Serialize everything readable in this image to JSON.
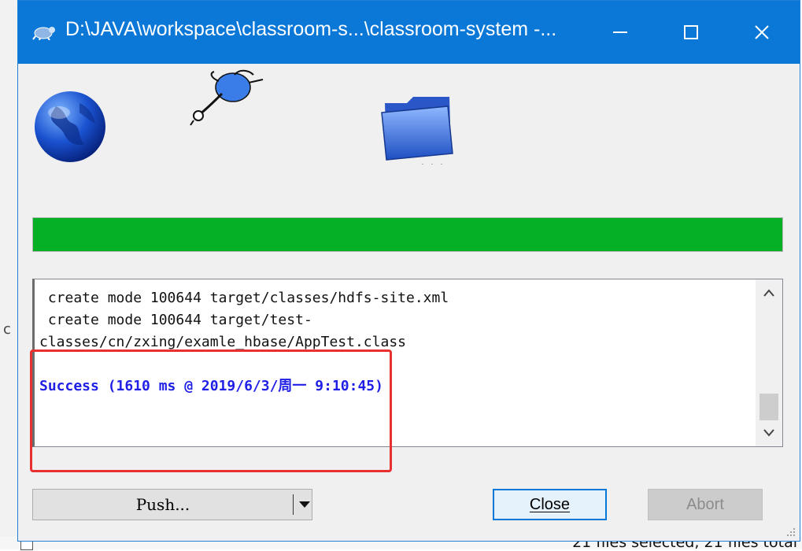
{
  "window": {
    "title": "D:\\JAVA\\workspace\\classroom-s...\\classroom-system -...",
    "minimize_label": "—",
    "maximize_label": "☐",
    "close_label": "✕"
  },
  "icons": {
    "app": "tortoise-git-icon",
    "globe": "globe-icon",
    "transfer": "jumping-figure-icon",
    "folder": "folder-icon"
  },
  "progress": {
    "value_percent": 100,
    "color": "#06b025"
  },
  "log": {
    "lines": [
      " create mode 100644 target/classes/hdfs-site.xml",
      " create mode 100644 target/test-",
      "classes/cn/zxing/examle_hbase/AppTest.class",
      "",
      "Success (1610 ms @ 2019/6/3/周一 9:10:45)"
    ],
    "success_color": "#1f1fe6"
  },
  "buttons": {
    "push": "Push...",
    "close": "Close",
    "abort": "Abort"
  },
  "background": {
    "status": "21 files selected, 21 files total"
  },
  "colors": {
    "titlebar": "#0b78d7",
    "highlight": "#e83030"
  }
}
